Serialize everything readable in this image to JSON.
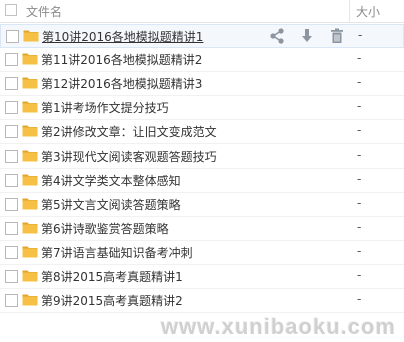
{
  "header": {
    "name_label": "文件名",
    "size_label": "大小"
  },
  "rows": [
    {
      "name": "第10讲2016各地模拟题精讲1",
      "size": "-",
      "hover": true
    },
    {
      "name": "第11讲2016各地模拟题精讲2",
      "size": "-"
    },
    {
      "name": "第12讲2016各地模拟题精讲3",
      "size": "-"
    },
    {
      "name": "第1讲考场作文提分技巧",
      "size": "-"
    },
    {
      "name": "第2讲修改文章：让旧文变成范文",
      "size": "-"
    },
    {
      "name": "第3讲现代文阅读客观题答题技巧",
      "size": "-"
    },
    {
      "name": "第4讲文学类文本整体感知",
      "size": "-"
    },
    {
      "name": "第5讲文言文阅读答题策略",
      "size": "-"
    },
    {
      "name": "第6讲诗歌鉴赏答题策略",
      "size": "-"
    },
    {
      "name": "第7讲语言基础知识备考冲刺",
      "size": "-"
    },
    {
      "name": "第8讲2015高考真题精讲1",
      "size": "-"
    },
    {
      "name": "第9讲2015高考真题精讲2",
      "size": "-"
    }
  ],
  "row_actions": [
    "share-icon",
    "download-icon",
    "delete-icon"
  ],
  "colors": {
    "folder": "#f5c043",
    "folder_dark": "#e0a52a",
    "hover_bg": "#f4f8fc",
    "icon": "#8c96a0"
  },
  "watermark": "www.xunibaoku.com"
}
